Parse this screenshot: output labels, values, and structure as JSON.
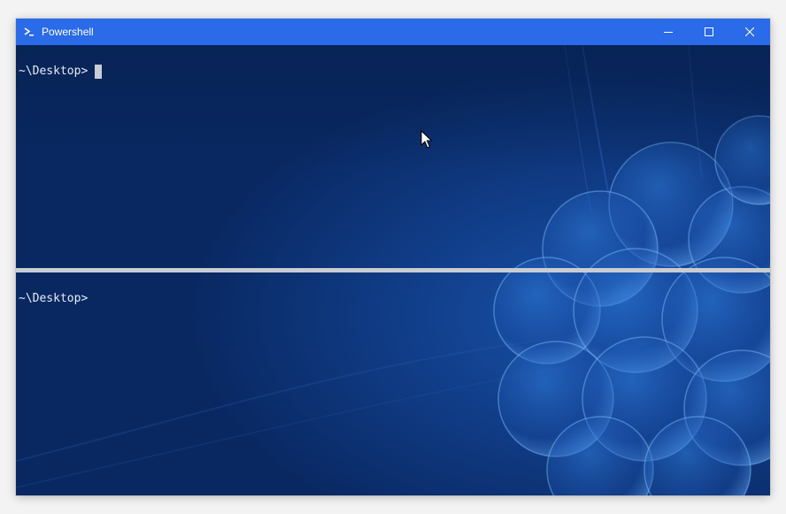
{
  "window": {
    "title": "Powershell",
    "accent_color": "#2b6bea",
    "controls": {
      "minimize": "minimize-icon",
      "maximize": "maximize-icon",
      "close": "close-icon"
    }
  },
  "panes": [
    {
      "prompt": "~\\Desktop>",
      "has_cursor": true
    },
    {
      "prompt": "~\\Desktop>",
      "has_cursor": false
    }
  ],
  "background_color": "#0a2a66"
}
